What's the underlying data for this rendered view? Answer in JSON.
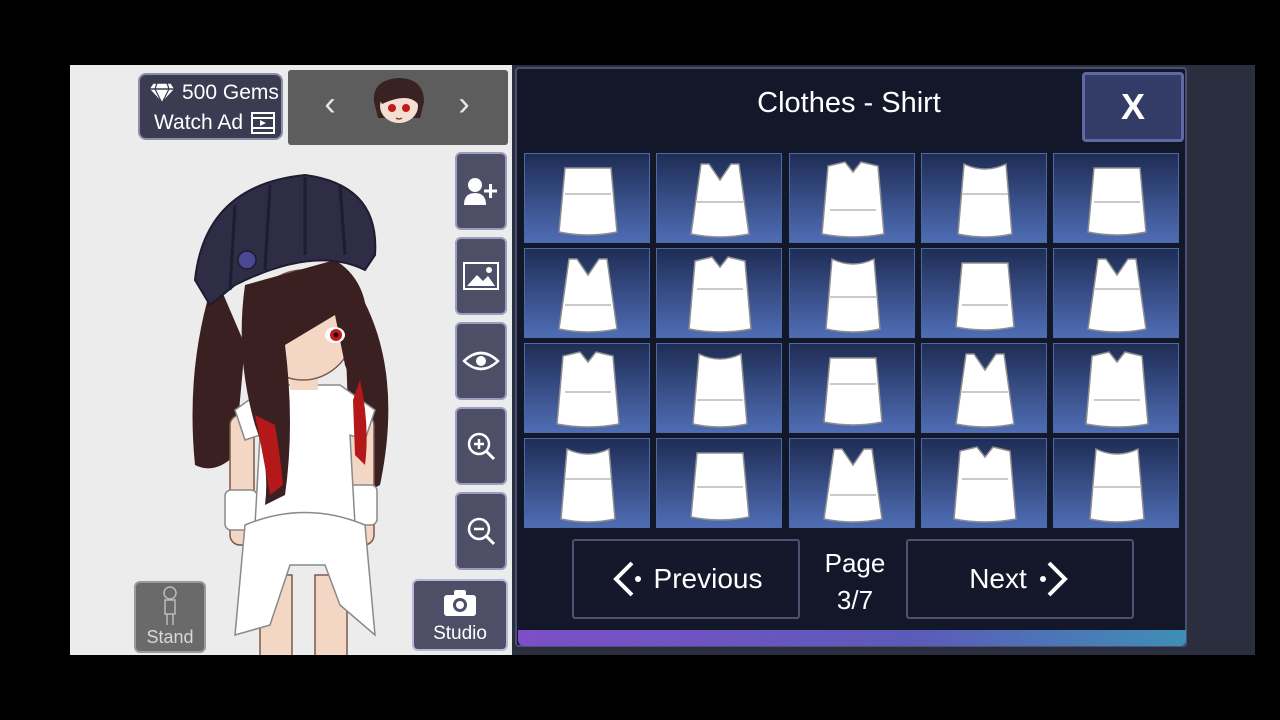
{
  "currency": {
    "gems_label": "500 Gems",
    "watch_ad_label": "Watch Ad"
  },
  "character_selector": {
    "prev_icon": "chevron-left-icon",
    "next_icon": "chevron-right-icon"
  },
  "side_tools": [
    {
      "name": "add-character-button",
      "icon": "add-person-icon"
    },
    {
      "name": "background-button",
      "icon": "image-icon"
    },
    {
      "name": "visibility-button",
      "icon": "eye-icon"
    },
    {
      "name": "zoom-in-button",
      "icon": "zoom-in-icon"
    },
    {
      "name": "zoom-out-button",
      "icon": "zoom-out-icon"
    }
  ],
  "bottom_buttons": {
    "stand_label": "Stand",
    "studio_label": "Studio"
  },
  "panel": {
    "title": "Clothes - Shirt",
    "close_label": "X",
    "previous_label": "Previous",
    "next_label": "Next",
    "page_label": "Page",
    "page_value": "3/7"
  },
  "colors": {
    "panel_bg": "#13172a",
    "item_gradient_top": "#1f2d55",
    "item_gradient_bottom": "#4f6db5",
    "accent": "#7d4fc7"
  },
  "shirt_items": [
    "tube-top-ruffle",
    "strappy-tank-lace",
    "open-vest",
    "open-shirt-striped",
    "button-vest",
    "heart-neck-top",
    "wrap-top",
    "button-cardigan",
    "button-shirt",
    "lace-trim-cami",
    "striped-crop-top",
    "banded-tank",
    "ribbed-tank",
    "striped-tank",
    "print-tank",
    "v-neck-cami",
    "ruffle-front-top",
    "dark-collar-top",
    "ribbed-halter",
    "button-tank"
  ]
}
